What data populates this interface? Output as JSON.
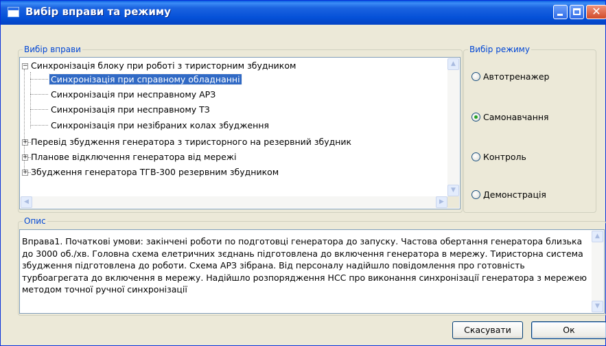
{
  "window": {
    "title": "Вибір вправи та режиму",
    "minimize": "_",
    "maximize": "□",
    "close": "✕"
  },
  "exercise_group": {
    "legend": "Вибір вправи",
    "tree": [
      {
        "label": "Синхронізація блоку при роботі з тиристорним збудником",
        "expanded": true,
        "children": [
          {
            "label": "Синхронізація при справному обладнанні",
            "selected": true
          },
          {
            "label": "Синхронізація при несправному АРЗ"
          },
          {
            "label": "Синхронізація при несправному ТЗ"
          },
          {
            "label": "Синхронізація при незібраних колах збудження"
          }
        ]
      },
      {
        "label": "Перевід збудження генератора з тиристорного на резервний збудник",
        "expanded": false
      },
      {
        "label": "Планове відключення генератора від мережі",
        "expanded": false
      },
      {
        "label": "Збудження генератора ТГВ-300 резервним збудником",
        "expanded": false
      }
    ],
    "expand_sign": "+",
    "collapse_sign": "−"
  },
  "mode_group": {
    "legend": "Вибір режиму",
    "options": [
      {
        "label": "Автотренажер",
        "checked": false
      },
      {
        "label": "Самонавчання",
        "checked": true
      },
      {
        "label": "Контроль",
        "checked": false
      },
      {
        "label": "Демонстрація",
        "checked": false
      }
    ]
  },
  "description_group": {
    "legend": "Опис",
    "text": "Вправа1. Початкові умови: закінчені роботи по подготовці генератора до запуску. Частова обертання генератора близька до 3000 об./хв. Головна схема елетричних зєднань підготовлена до включення генератора в мережу. Тиристорна система збудження підготовлена до роботи. Схема АРЗ зібрана. Від персоналу надійшло повідомлення про готовність турбоагрегата до включення в мережу. Надійшло розпорядження НСС про виконання синхронізації генератора з мережею методом точної ручної синхронізації"
  },
  "buttons": {
    "cancel": "Скасувати",
    "ok": "Ок"
  },
  "scroll_arrows": {
    "up": "▲",
    "down": "▼",
    "left": "◀",
    "right": "▶"
  }
}
